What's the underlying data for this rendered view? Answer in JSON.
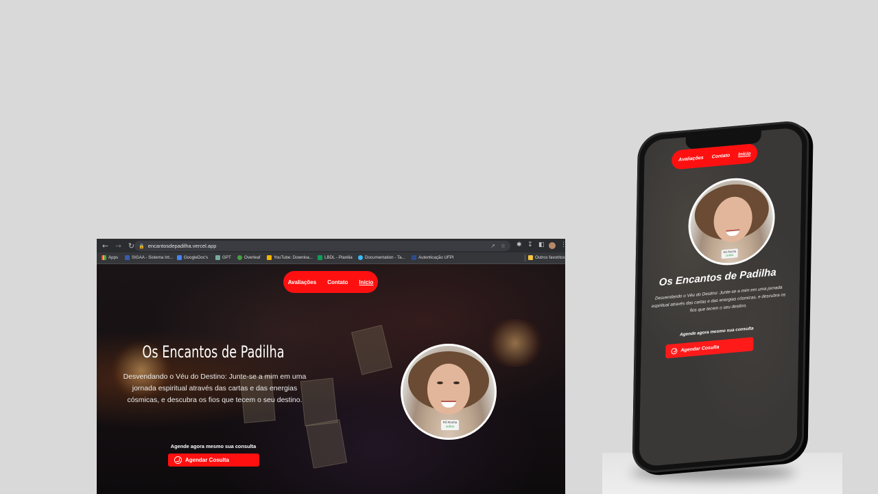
{
  "browser": {
    "url": "encantosdepadilha.vercel.app",
    "bookmarks": [
      {
        "label": "Apps",
        "color": "#e8453c"
      },
      {
        "label": "SIGAA - Sistema Int...",
        "color": "#3b5ba9"
      },
      {
        "label": "GoogleDoc's",
        "color": "#4285f4"
      },
      {
        "label": "GPT",
        "color": "#74aa9c"
      },
      {
        "label": "Overleaf",
        "color": "#47a141"
      },
      {
        "label": "YouTube: Downloa...",
        "color": "#f4b400"
      },
      {
        "label": "LBDL - Planilia",
        "color": "#0f9d58"
      },
      {
        "label": "Documentation - Ta...",
        "color": "#38bdf8"
      },
      {
        "label": "Autenticação UFPI",
        "color": "#2e4a8a"
      },
      {
        "label": "Outros favoritos",
        "color": "#f5c542"
      }
    ]
  },
  "site": {
    "nav": [
      {
        "label": "Avaliações"
      },
      {
        "label": "Contato"
      },
      {
        "label": "Início"
      }
    ],
    "title": "Os Encantos de Padilha",
    "description": "Desvendando o Véu do Destino: Junte-se a mim em uma jornada espiritual através das cartas e das energias cósmicas, e descubra os fios que tecem o seu destino.",
    "cta_text": "Agende agora mesmo sua consulta",
    "cta_button": "Agendar Cosulta",
    "badge_name": "Rô Rocha",
    "badge_status": "online",
    "accent": "#ff1010"
  }
}
